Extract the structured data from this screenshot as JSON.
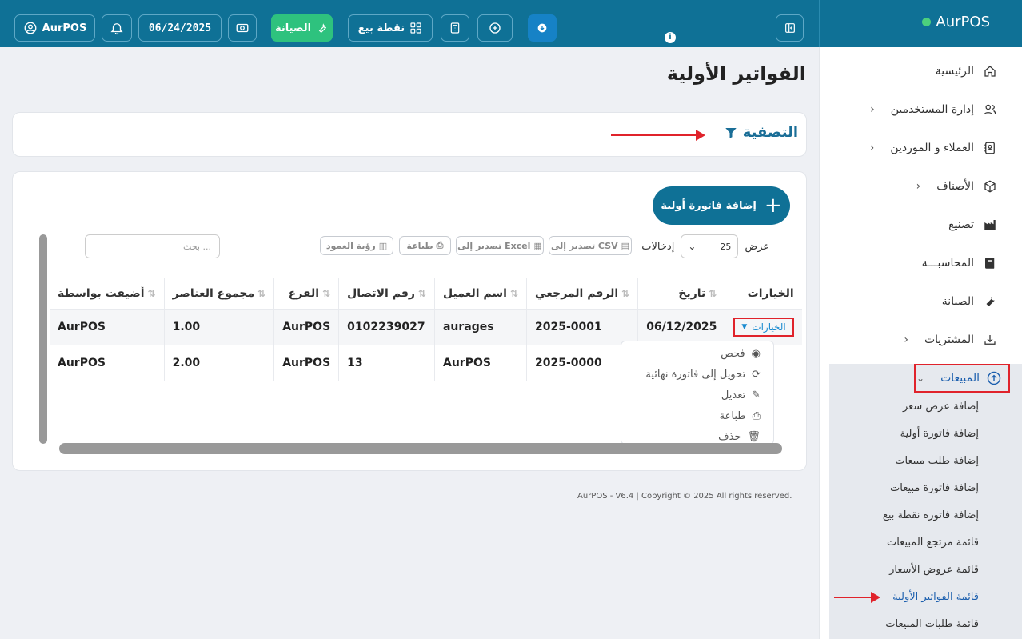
{
  "brand": {
    "name": "AurPOS",
    "status_color": "#4cd07d"
  },
  "topbar": {
    "user_label": "AurPOS",
    "date": "06/24/2025",
    "maintenance_label": "الصيانة",
    "pos_label": "نقطة بيع",
    "info": "i"
  },
  "page": {
    "title": "الفواتير الأولية"
  },
  "filter": {
    "title": "التصفية"
  },
  "toolbar": {
    "add_label": "إضافة فاتورة أولية",
    "show_label": "عرض",
    "entries_label": "إدخالات",
    "page_size": "25",
    "csv_label": "تصدير إلى CSV",
    "excel_label": "تصدير إلى Excel",
    "print_label": "طباعة",
    "columns_label": "رؤية العمود",
    "search_placeholder": "بحث ..."
  },
  "table": {
    "headers": [
      "الخيارات",
      "تاريخ",
      "الرقم المرجعي",
      "اسم العميل",
      "رقم الاتصال",
      "الفرع",
      "مجموع العناصر",
      "أضيفت بواسطة"
    ],
    "options_label": "الخيارات",
    "rows": [
      {
        "date": "06/12/2025",
        "ref": "2025-0001",
        "customer": "aurages",
        "phone": "0102239027",
        "branch": "AurPOS",
        "total": "1.00",
        "added_by": "AurPOS"
      },
      {
        "date": "",
        "ref": "2025-0000",
        "customer": "AurPOS",
        "phone": "13",
        "branch": "AurPOS",
        "total": "2.00",
        "added_by": "AurPOS"
      }
    ]
  },
  "dropdown": {
    "items": [
      "فحص",
      "تحويل إلى فاتورة نهائية",
      "تعديل",
      "طباعة",
      "حذف"
    ]
  },
  "sidebar": {
    "items": [
      {
        "label": "الرئيسية"
      },
      {
        "label": "إدارة المستخدمين"
      },
      {
        "label": "العملاء و الموردين"
      },
      {
        "label": "الأصناف"
      },
      {
        "label": "تصنيع"
      },
      {
        "label": "المحاسبـــة"
      },
      {
        "label": "الصيانة"
      },
      {
        "label": "المشتريات"
      },
      {
        "label": "المبيعات"
      }
    ],
    "sales_sub": [
      "إضافة عرض سعر",
      "إضافة فاتورة أولية",
      "إضافة طلب مبيعات",
      "إضافة فاتورة مبيعات",
      "إضافة فاتورة نقطة بيع",
      "قائمة مرتجع المبيعات",
      "قائمة عروض الأسعار",
      "قائمة الفواتير الأولية",
      "قائمة طلبات المبيعات"
    ]
  },
  "footer": {
    "text": "AurPOS - V6.4 | Copyright © 2025 All rights reserved."
  },
  "colors": {
    "primary": "#0f7196",
    "accent_green": "#2ec27e",
    "highlight_red": "#e0232b",
    "link_blue": "#1c5fae"
  }
}
